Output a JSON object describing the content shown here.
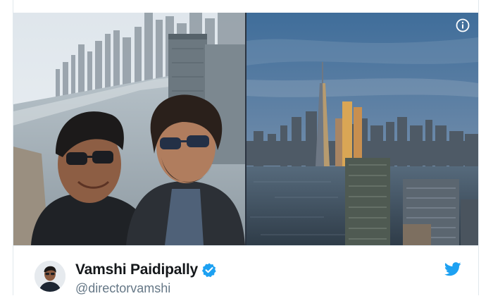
{
  "tweet": {
    "author_name": "Vamshi Paidipally",
    "author_handle": "@directorvamshi",
    "verified": true
  },
  "icons": {
    "info": "info-icon",
    "verified": "verified-badge-icon",
    "brand": "twitter-bird-icon"
  },
  "colors": {
    "brand_blue": "#1da1f2",
    "name_text": "#14171a",
    "handle_text": "#657786"
  }
}
